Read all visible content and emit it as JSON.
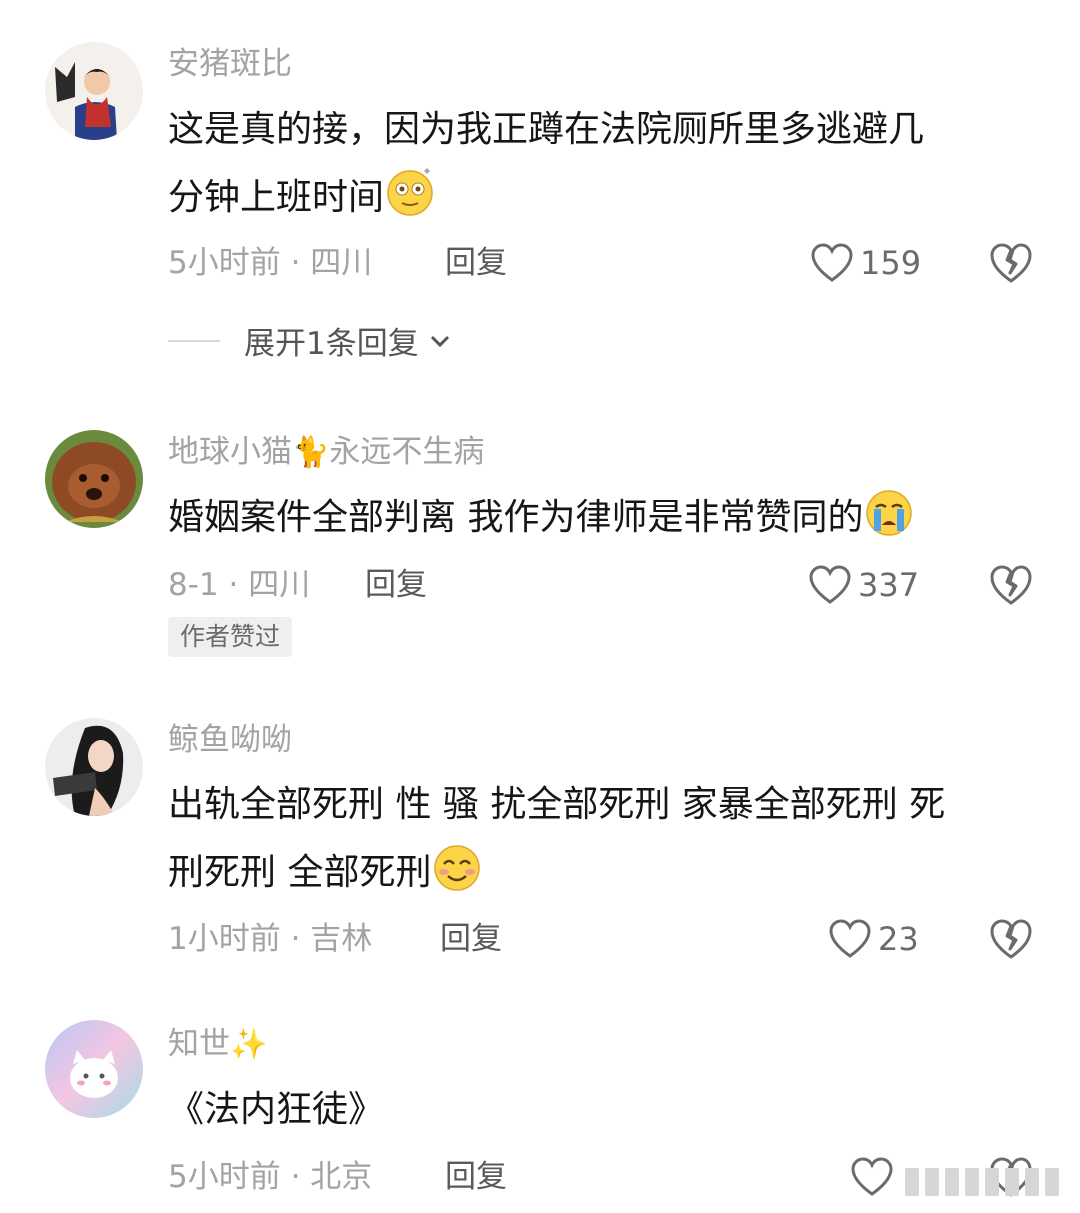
{
  "comments": [
    {
      "username": "安猪斑比",
      "text_line1": "这是真的接，因为我正蹲在法院厕所里多逃避几",
      "text_line2": "分钟上班时间",
      "meta": "5小时前 · 四川",
      "reply": "回复",
      "likes": "159"
    },
    {
      "username_a": "地球小猫",
      "username_emoji": "🐈",
      "username_b": "永远不生病",
      "text_line1": "婚姻案件全部判离 我作为律师是非常赞同的",
      "meta": "8-1 · 四川",
      "reply": "回复",
      "likes": "337",
      "badge": "作者赞过"
    },
    {
      "username": "鲸鱼呦呦",
      "text_line1": "出轨全部死刑 性 骚 扰全部死刑 家暴全部死刑 死",
      "text_line2": "刑死刑 全部死刑",
      "meta": "1小时前 · 吉林",
      "reply": "回复",
      "likes": "23"
    },
    {
      "username": "知世",
      "username_emoji": "✨",
      "text_line1": "《法内狂徒》",
      "meta": "5小时前 · 北京",
      "reply": "回复"
    }
  ],
  "expand_replies": "展开1条回复",
  "icons": {
    "like": "heart-outline-icon",
    "dislike": "broken-heart-icon",
    "expand": "chevron-down-icon"
  },
  "colors": {
    "text": "#161616",
    "muted": "#a3a3a3",
    "icon": "#6b6b6b"
  }
}
